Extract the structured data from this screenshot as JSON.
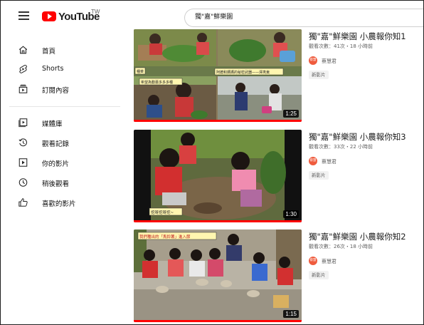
{
  "app": {
    "logo_text": "YouTube",
    "region": "TW"
  },
  "search": {
    "value": "獨\"嘉\"鮮樂園"
  },
  "sidebar": {
    "items": [
      {
        "label": "首頁",
        "icon": "home-icon"
      },
      {
        "label": "Shorts",
        "icon": "shorts-icon"
      },
      {
        "label": "訂閱內容",
        "icon": "subscriptions-icon"
      },
      {
        "label": "媒體庫",
        "icon": "library-icon"
      },
      {
        "label": "觀看記錄",
        "icon": "history-icon"
      },
      {
        "label": "你的影片",
        "icon": "your-videos-icon"
      },
      {
        "label": "稍後觀看",
        "icon": "watch-later-icon"
      },
      {
        "label": "喜歡的影片",
        "icon": "liked-videos-icon"
      }
    ]
  },
  "videos": [
    {
      "title": "獨\"嘉\"鮮樂園 小農報你知1",
      "meta": "觀看次數：41次・18 小時前",
      "channel": "蔡慧君",
      "avatar_text": "蔡慧",
      "badge": "新影片",
      "duration": "1:25",
      "progress": 1.0,
      "captions": [
        "種菜",
        "阿嬤和媽媽的秘密武器——澤夷東",
        "希望為動蕾多多多種"
      ]
    },
    {
      "title": "獨\"嘉\"鮮樂園 小農報你知3",
      "meta": "觀看次數：33次・22 小時前",
      "channel": "蔡慧君",
      "avatar_text": "蔡慧",
      "badge": "新影片",
      "duration": "1:30",
      "progress": 1.0,
      "captions": [
        "挖呀挖呀挖~"
      ]
    },
    {
      "title": "獨\"嘉\"鮮樂園 小農報你知2",
      "meta": "觀看次數：26次・18 小時前",
      "channel": "蔡慧君",
      "avatar_text": "蔡慧",
      "badge": "新影片",
      "duration": "1:15",
      "progress": 1.0,
      "captions": [
        "我們種出的「馬鈴薯」進入節"
      ]
    }
  ],
  "colors": {
    "accent": "#ff0000",
    "avatar": "#ef5b3d"
  }
}
